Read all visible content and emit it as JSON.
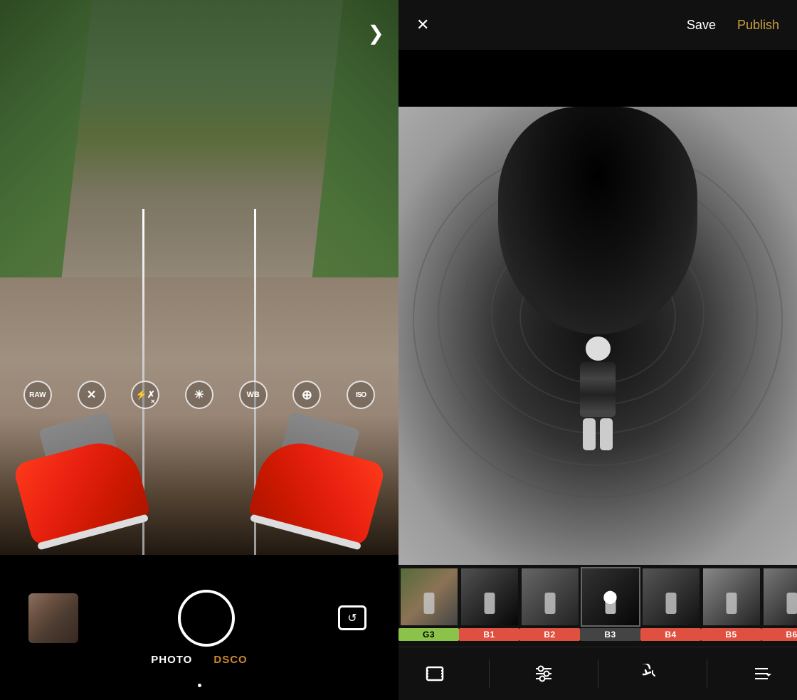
{
  "left": {
    "next_label": "❯",
    "controls": {
      "raw_label": "RAW",
      "x_label": "✕",
      "flash_label": "⚡",
      "flash_x_label": "✕",
      "sun_label": "☀",
      "wb_label": "WB",
      "plus_label": "⊕",
      "iso_label": "ISO"
    },
    "mode_photo": "PHOTO",
    "mode_dsco": "DSCO"
  },
  "right": {
    "header": {
      "close_label": "✕",
      "save_label": "Save",
      "publish_label": "Publish"
    },
    "filters": [
      {
        "id": "G3",
        "label": "G3",
        "style": "ft-color",
        "label_class": "active-g3",
        "selected": false
      },
      {
        "id": "B1",
        "label": "B1",
        "style": "ft-bw1",
        "label_class": "active-b1",
        "selected": false
      },
      {
        "id": "B2",
        "label": "B2",
        "style": "ft-bw2",
        "label_class": "active-b2",
        "selected": false
      },
      {
        "id": "B3",
        "label": "B3",
        "style": "ft-bw3",
        "label_class": "active-b3",
        "selected": true
      },
      {
        "id": "B4",
        "label": "B4",
        "style": "ft-bw4",
        "label_class": "active-b4",
        "selected": false
      },
      {
        "id": "B5",
        "label": "B5",
        "style": "ft-bw5",
        "label_class": "active-b5",
        "selected": false
      },
      {
        "id": "B6",
        "label": "B6",
        "style": "ft-bw6",
        "label_class": "active-b6",
        "selected": false
      }
    ],
    "toolbar": {
      "frame_label": "frame",
      "adjust_label": "adjust",
      "history_label": "history",
      "more_label": "more"
    }
  }
}
